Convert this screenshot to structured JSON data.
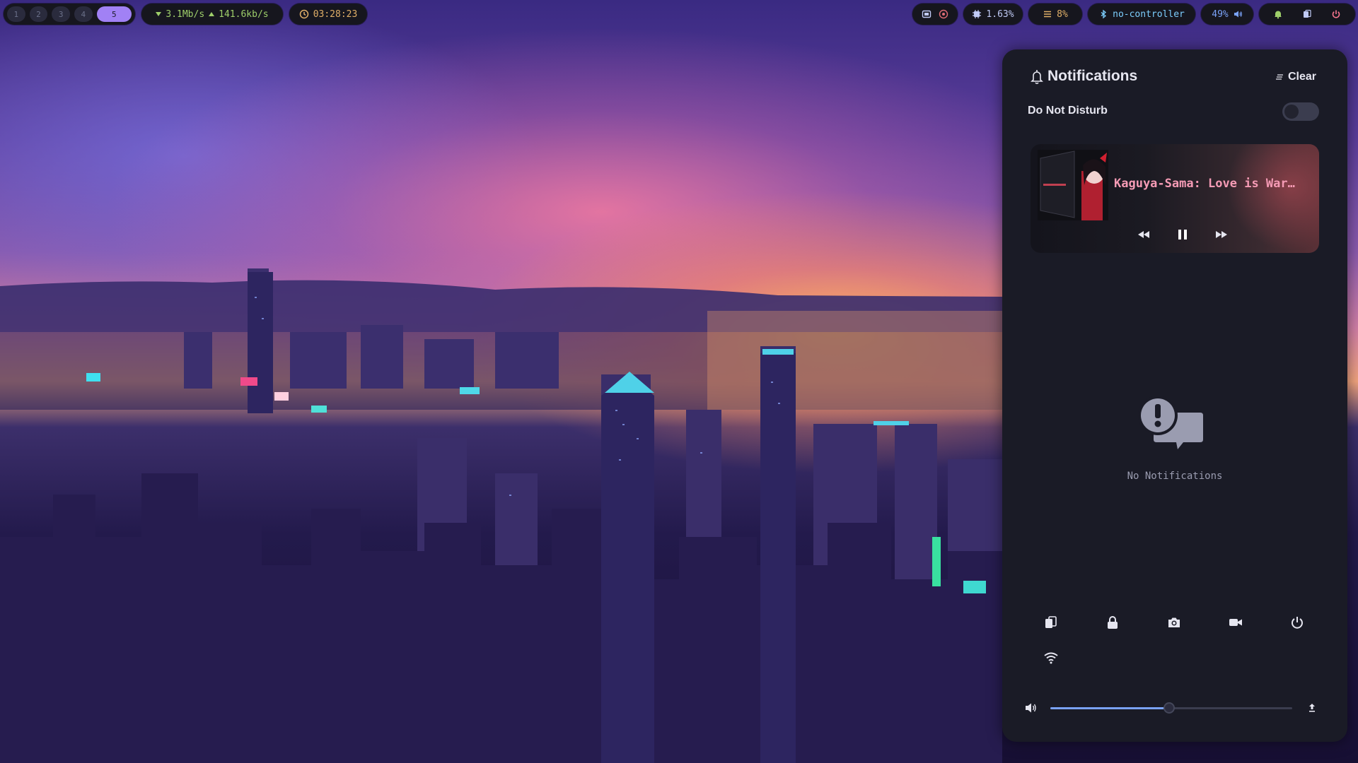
{
  "topbar": {
    "workspaces": [
      "1",
      "2",
      "3",
      "4",
      "5"
    ],
    "active_workspace": "5",
    "network": {
      "down": "3.1Mb/s",
      "up": "141.6kb/s"
    },
    "clock": "03:28:23",
    "cpu": "1.63%",
    "memory": "8%",
    "bluetooth": "no-controller",
    "volume": "49%"
  },
  "notifications": {
    "title": "Notifications",
    "clear_label": "Clear",
    "dnd_label": "Do Not Disturb",
    "dnd_enabled": false,
    "empty_text": "No Notifications"
  },
  "media": {
    "title": "Kaguya-Sama: Love is War…"
  },
  "volume_slider": {
    "value_percent": 49
  },
  "icons": {
    "workspaces": "workspace-dot",
    "tray": [
      "tray-app-icon",
      "tray-browser-icon"
    ],
    "quick_actions": [
      "clipboard-icon",
      "lock-icon",
      "screenshot-icon",
      "record-icon",
      "power-icon",
      "wifi-icon"
    ]
  },
  "colors": {
    "accent": "#a181f5",
    "bar_bg": "#16161e",
    "panel_bg": "#1a1b26",
    "net_green": "#9ece6a",
    "clock_yellow": "#e0af68",
    "bt_cyan": "#7dcfff",
    "audio_blue": "#7aa2f7",
    "media_title_pink": "#f59bb5",
    "bell_green": "#9ece6a",
    "power_red": "#f7768e"
  }
}
